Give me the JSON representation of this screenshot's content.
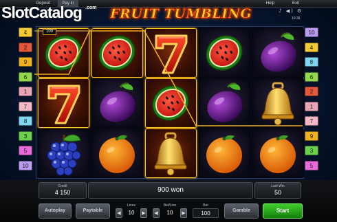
{
  "top_bar": {
    "deposit_label": "Deposit",
    "payin_label": "Pay in",
    "help_label": "Help",
    "exit_label": "Exit",
    "clock": "10:36",
    "sys_icons": "♪ ◀) ⚙"
  },
  "watermark": {
    "text_a": "Slot",
    "text_b": "Catalog",
    "suffix": ".com"
  },
  "game": {
    "title": "FRUIT TUMBLING",
    "win_badge": "100"
  },
  "reels": [
    [
      "watermelon",
      "seven",
      "grapes"
    ],
    [
      "watermelon",
      "plum",
      "orange"
    ],
    [
      "seven",
      "watermelon",
      "bell"
    ],
    [
      "watermelon",
      "plum",
      "orange"
    ],
    [
      "plum",
      "bell",
      "orange"
    ]
  ],
  "highlighted_cells": [
    [
      0,
      0
    ],
    [
      0,
      1
    ],
    [
      1,
      0
    ],
    [
      2,
      0
    ],
    [
      2,
      1
    ],
    [
      2,
      2
    ]
  ],
  "left_markers": [
    {
      "num": "4",
      "color": "#f2c834"
    },
    {
      "num": "2",
      "color": "#e2563a"
    },
    {
      "num": "9",
      "color": "#f0b020"
    },
    {
      "num": "6",
      "color": "#8fd94a"
    },
    {
      "num": "1",
      "color": "#e8a3b4"
    },
    {
      "num": "7",
      "color": "#f4b8c4"
    },
    {
      "num": "8",
      "color": "#7fd6f0"
    },
    {
      "num": "3",
      "color": "#6bcf4e"
    },
    {
      "num": "5",
      "color": "#e86ad8"
    },
    {
      "num": "10",
      "color": "#b99cf0"
    }
  ],
  "right_markers": [
    {
      "num": "10",
      "color": "#b99cf0"
    },
    {
      "num": "4",
      "color": "#f2c834"
    },
    {
      "num": "8",
      "color": "#7fd6f0"
    },
    {
      "num": "6",
      "color": "#8fd94a"
    },
    {
      "num": "2",
      "color": "#e2563a"
    },
    {
      "num": "1",
      "color": "#e8a3b4"
    },
    {
      "num": "7",
      "color": "#f4b8c4"
    },
    {
      "num": "9",
      "color": "#f0b020"
    },
    {
      "num": "3",
      "color": "#6bcf4e"
    },
    {
      "num": "5",
      "color": "#e86ad8"
    }
  ],
  "panel": {
    "credit_label": "Credit",
    "credit_value": "4 150",
    "win_text": "900 won",
    "lastwin_label": "Last Win",
    "lastwin_value": "50",
    "autoplay_label": "Autoplay",
    "paytable_label": "Paytable",
    "lines_label": "Lines",
    "lines_value": "10",
    "betline_label": "Bet/Line",
    "betline_value": "10",
    "bet_label": "Bet",
    "bet_value": "100",
    "gamble_label": "Gamble",
    "start_label": "Start"
  }
}
